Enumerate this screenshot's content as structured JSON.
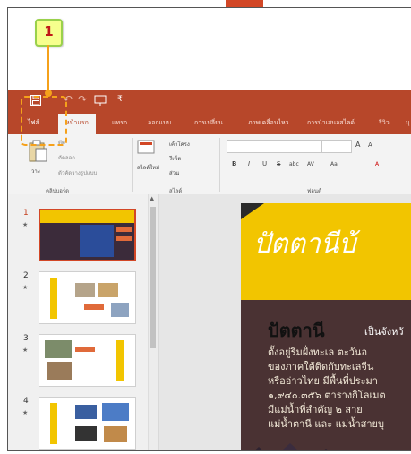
{
  "callout": {
    "number": "1"
  },
  "quick_access": {
    "save_icon": "save-icon",
    "undo": "↶",
    "redo": "↷"
  },
  "tabs": [
    "ไฟล์",
    "หน้าแรก",
    "แทรก",
    "ออกแบบ",
    "การเปลี่ยน",
    "ภาพเคลื่อนไหว",
    "การนำเสนอสไลด์",
    "รีวิว",
    "มุ"
  ],
  "active_tab": "หน้าแรก",
  "ribbon": {
    "clipboard": {
      "paste": "วาง",
      "cut": "ตัด",
      "copy": "คัดลอก",
      "format_painter": "ตัวคัดวางรูปแบบ",
      "label": "คลิปบอร์ด"
    },
    "slides": {
      "new_slide": "สไลด์ใหม่",
      "layout": "เค้าโครง",
      "reset": "รีเซ็ต",
      "section": "ส่วน",
      "label": "สไลด์"
    },
    "font": {
      "bold": "B",
      "italic": "I",
      "underline": "U",
      "strike": "S",
      "abc": "abc",
      "spacing": "AV",
      "case": "Aa",
      "grow": "A",
      "shrink": "A",
      "label": "ฟอนต์"
    }
  },
  "slides": [
    {
      "number": "1",
      "selected": true
    },
    {
      "number": "2",
      "selected": false
    },
    {
      "number": "3",
      "selected": false
    },
    {
      "number": "4",
      "selected": false
    }
  ],
  "slide": {
    "title": "ปัตตานีบ้",
    "body_title": "ปัตตานี",
    "body_title_suffix": "เป็นจังหวั",
    "lines": [
      "ตั้งอยู่ริมฝั่งทะเล ตะวันอ",
      "ของภาคใต้ติดกับทะเลจีน",
      "หรืออ่าวไทย มีพื้นที่ประมา",
      "๑,๙๔๐.๓๕๖ ตารางกิโลเมต",
      "มีแม่น้ำที่สำคัญ ๒ สาย",
      "แม่น้ำตานี และ แม่น้ำสายบุ"
    ]
  },
  "colors": {
    "accent": "#b7472a",
    "callout_bg": "#f6ff8d",
    "callout_border": "#9ad14b",
    "highlight": "#f5a11b",
    "slide_yellow": "#f2c500"
  }
}
